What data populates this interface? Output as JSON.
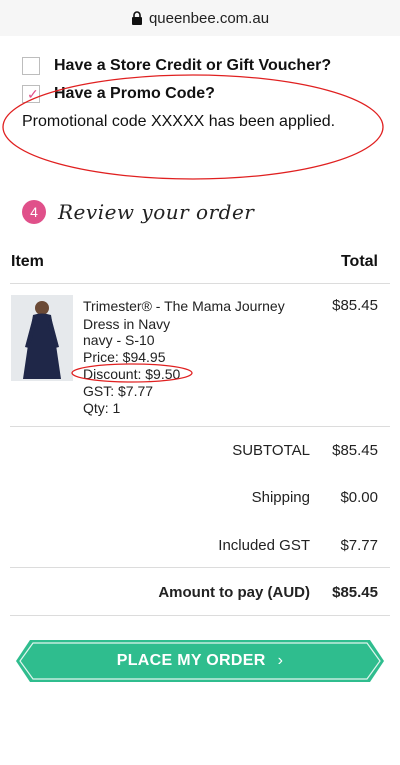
{
  "browser": {
    "url": "queenbee.com.au"
  },
  "options": [
    {
      "label": "Have a Store Credit or Gift Voucher?",
      "checked": false
    },
    {
      "label": "Have a Promo Code?",
      "checked": true
    }
  ],
  "promo_message": "Promotional code XXXXX has been applied.",
  "step": {
    "number": "4",
    "title": "Review your order"
  },
  "table": {
    "col_item": "Item",
    "col_total": "Total"
  },
  "product": {
    "name": "Trimester® - The Mama Journey Dress in Navy",
    "variant": "navy - S-10",
    "price": "Price: $94.95",
    "discount": "Discount: $9.50",
    "gst": "GST: $7.77",
    "qty": "Qty: 1",
    "total": "$85.45"
  },
  "summary": {
    "subtotal_label": "SUBTOTAL",
    "subtotal_value": "$85.45",
    "shipping_label": "Shipping",
    "shipping_value": "$0.00",
    "gst_label": "Included GST",
    "gst_value": "$7.77",
    "amount_label": "Amount to pay (AUD)",
    "amount_value": "$85.45"
  },
  "cta": {
    "label": "PLACE MY ORDER",
    "chevron": "›"
  },
  "colors": {
    "accent": "#e0508a",
    "button": "#2fbd8e",
    "annotation": "#e02020"
  }
}
